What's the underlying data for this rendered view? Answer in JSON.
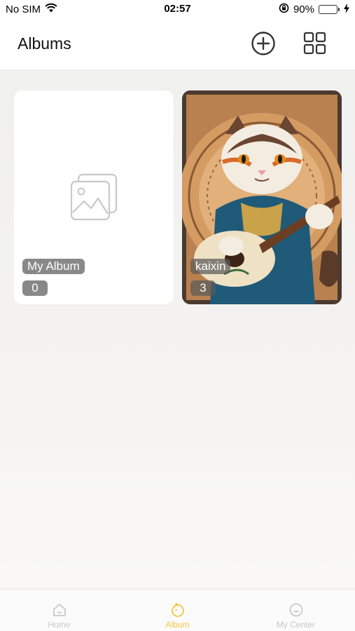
{
  "status_bar": {
    "carrier": "No SIM",
    "time": "02:57",
    "battery_percent": "90%",
    "battery_level": 0.9
  },
  "header": {
    "title": "Albums",
    "add_icon": "plus-circle-icon",
    "layout_icon": "grid-icon"
  },
  "albums": [
    {
      "name": "My Album",
      "count": "0",
      "cover": "placeholder-image-icon"
    },
    {
      "name": "kaixin",
      "count": "3",
      "cover": "cat-guitar-illustration"
    }
  ],
  "tabbar": {
    "items": [
      {
        "label": "Home",
        "icon": "home-icon",
        "active": false
      },
      {
        "label": "Album",
        "icon": "album-icon",
        "active": true
      },
      {
        "label": "My Center",
        "icon": "smile-icon",
        "active": false
      }
    ]
  },
  "colors": {
    "accent": "#f5c542",
    "inactive": "#c8c8c8",
    "battery": "#3fcf4f"
  }
}
